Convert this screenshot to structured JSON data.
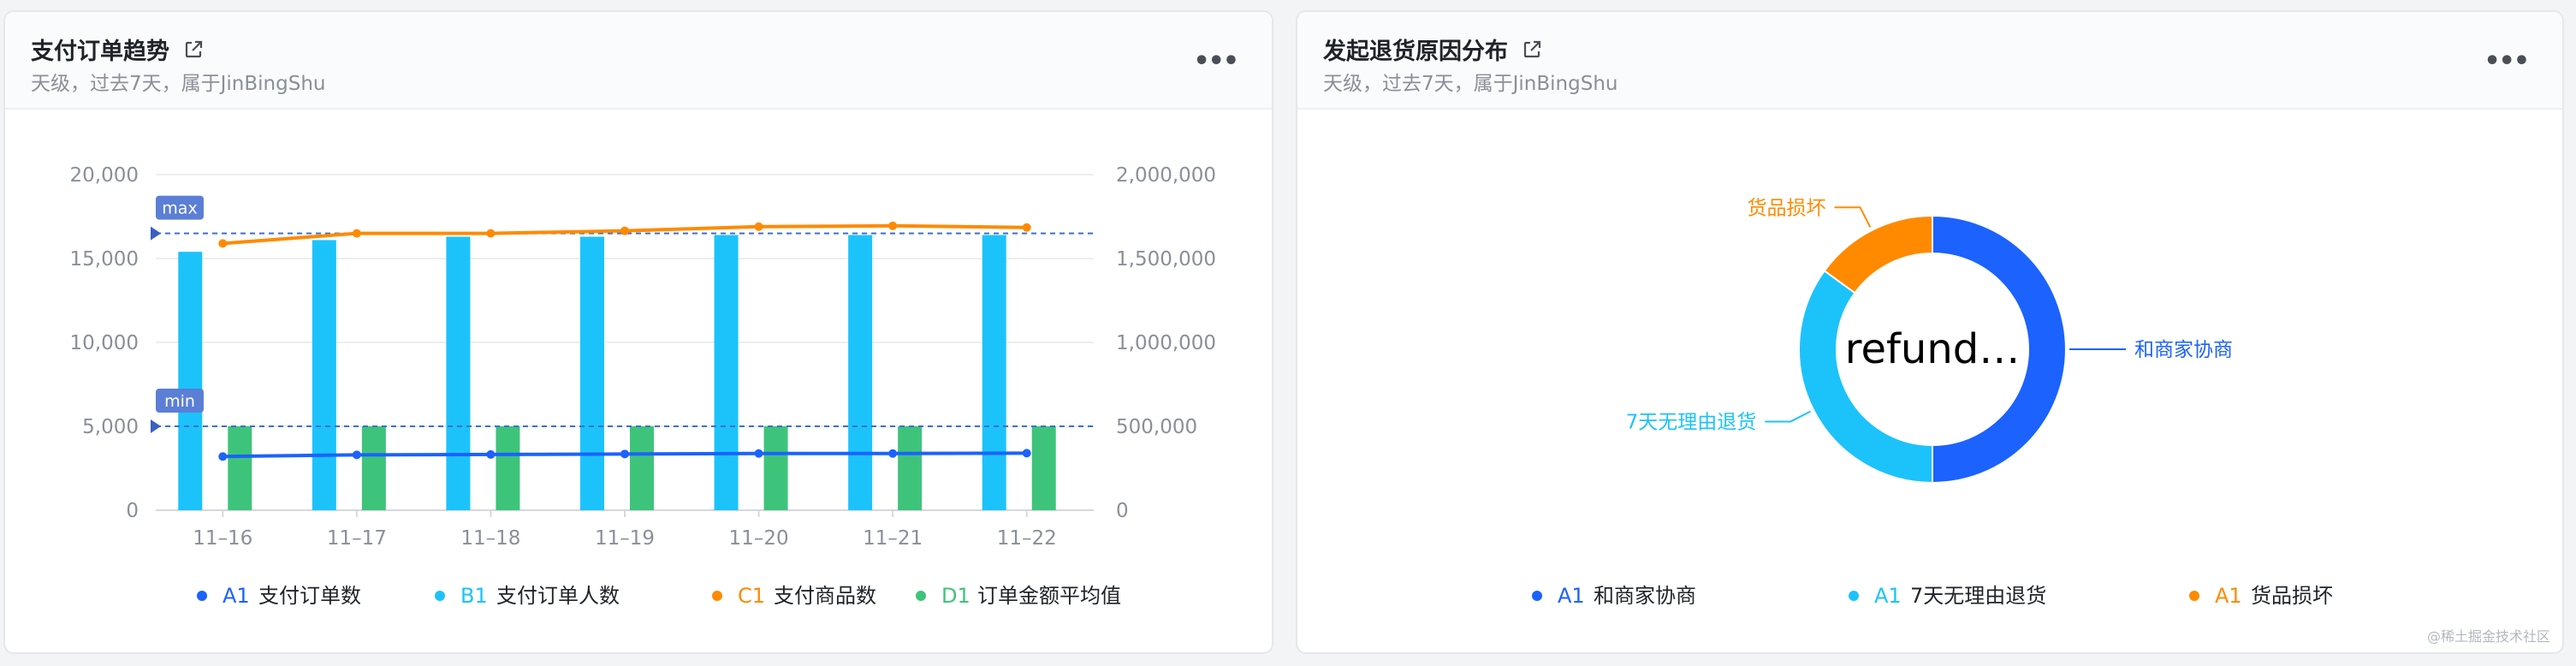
{
  "cards": [
    {
      "title": "支付订单趋势",
      "subtitle": "天级，过去7天，属于JinBingShu"
    },
    {
      "title": "发起退货原因分布",
      "subtitle": "天级，过去7天，属于JinBingShu"
    }
  ],
  "more_label": "•••",
  "watermark": "@稀土掘金技术社区",
  "colors": {
    "blue": "#1b62ff",
    "cyan": "#1cc3fa",
    "orange": "#ff8a00",
    "green": "#3ec47a",
    "marker": "#5b7fd6"
  },
  "chart_data": [
    {
      "type": "bar",
      "categories": [
        "11–16",
        "11–17",
        "11–18",
        "11–19",
        "11–20",
        "11–21",
        "11–22"
      ],
      "y_left_ticks": [
        "0",
        "5,000",
        "10,000",
        "15,000",
        "20,000"
      ],
      "y_right_ticks": [
        "0",
        "500,000",
        "1,000,000",
        "1,500,000",
        "2,000,000"
      ],
      "ylim_left": [
        0,
        20000
      ],
      "ylim_right": [
        0,
        2000000
      ],
      "reference_lines": [
        {
          "label": "max",
          "value": 16500
        },
        {
          "label": "min",
          "value": 5000
        }
      ],
      "series": [
        {
          "tag": "A1",
          "name": "支付订单数",
          "kind": "line",
          "axis": "left",
          "color": "#1b62ff",
          "values": [
            3200,
            3300,
            3320,
            3350,
            3380,
            3380,
            3400
          ]
        },
        {
          "tag": "B1",
          "name": "支付订单人数",
          "kind": "bar",
          "axis": "left",
          "color": "#1cc3fa",
          "values": [
            15400,
            16100,
            16300,
            16300,
            16400,
            16400,
            16400
          ]
        },
        {
          "tag": "C1",
          "name": "支付商品数",
          "kind": "line",
          "axis": "left",
          "color": "#ff8a00",
          "values": [
            15900,
            16500,
            16500,
            16650,
            16900,
            16950,
            16850
          ]
        },
        {
          "tag": "D1",
          "name": "订单金额平均值",
          "kind": "bar",
          "axis": "right",
          "color": "#3ec47a",
          "values": [
            500000,
            500000,
            500000,
            500000,
            500000,
            500000,
            500000
          ]
        }
      ]
    },
    {
      "type": "pie",
      "center_label": "refund…",
      "slices": [
        {
          "tag": "A1",
          "label": "和商家协商",
          "value": 50,
          "color": "#1b62ff"
        },
        {
          "tag": "A1",
          "label": "7天无理由退货",
          "value": 35,
          "color": "#1cc3fa"
        },
        {
          "tag": "A1",
          "label": "货品损坏",
          "value": 15,
          "color": "#ff8a00"
        }
      ]
    }
  ]
}
